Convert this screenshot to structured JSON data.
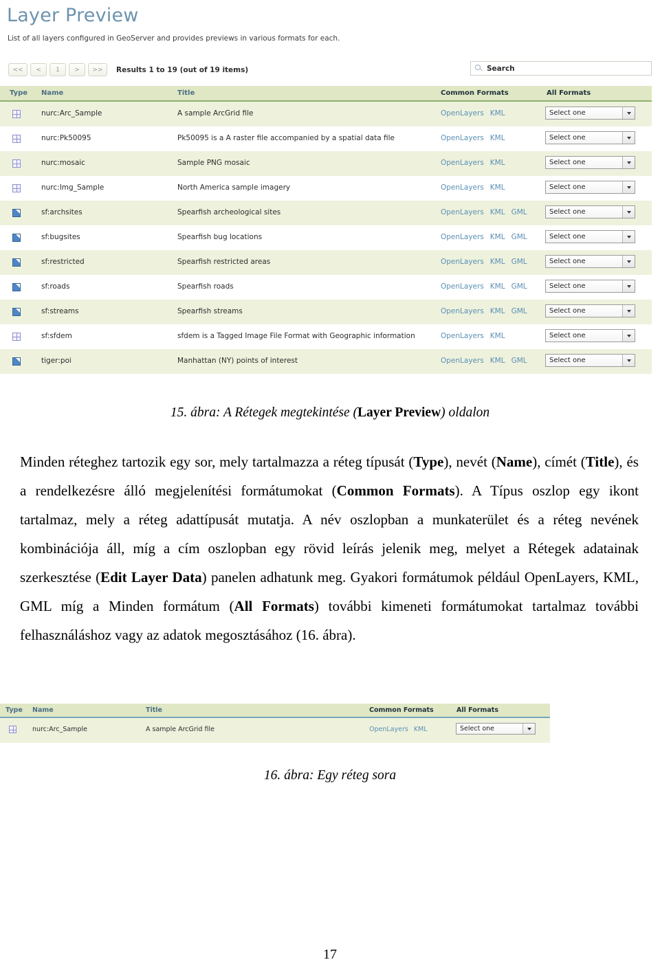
{
  "figure15": {
    "app_title": "Layer Preview",
    "description": "List of all layers configured in GeoServer and provides previews in various formats for each.",
    "pager": {
      "first_label": "<<",
      "prev_label": "<",
      "page_label": "1",
      "next_label": ">",
      "last_label": ">>",
      "results_text": "Results 1 to 19 (out of 19 items)"
    },
    "search": {
      "placeholder": "Search",
      "icon": "search-icon"
    },
    "columns": {
      "type": "Type",
      "name": "Name",
      "title": "Title",
      "common_formats": "Common Formats",
      "all_formats": "All Formats"
    },
    "select_placeholder": "Select one",
    "rows": [
      {
        "type_icon": "raster-grid-icon",
        "type": "raster",
        "name": "nurc:Arc_Sample",
        "title": "A sample ArcGrid file",
        "formats": [
          "OpenLayers",
          "KML"
        ],
        "all_formats": "Select one"
      },
      {
        "type_icon": "raster-grid-icon",
        "type": "raster",
        "name": "nurc:Pk50095",
        "title": "Pk50095 is a A raster file accompanied by a spatial data file",
        "formats": [
          "OpenLayers",
          "KML"
        ],
        "all_formats": "Select one"
      },
      {
        "type_icon": "raster-grid-icon",
        "type": "raster",
        "name": "nurc:mosaic",
        "title": "Sample PNG mosaic",
        "formats": [
          "OpenLayers",
          "KML"
        ],
        "all_formats": "Select one"
      },
      {
        "type_icon": "raster-grid-icon",
        "type": "raster",
        "name": "nurc:Img_Sample",
        "title": "North America sample imagery",
        "formats": [
          "OpenLayers",
          "KML"
        ],
        "all_formats": "Select one"
      },
      {
        "type_icon": "vector-polygon-icon",
        "type": "vector",
        "name": "sf:archsites",
        "title": "Spearfish archeological sites",
        "formats": [
          "OpenLayers",
          "KML",
          "GML"
        ],
        "all_formats": "Select one"
      },
      {
        "type_icon": "vector-polygon-icon",
        "type": "vector",
        "name": "sf:bugsites",
        "title": "Spearfish bug locations",
        "formats": [
          "OpenLayers",
          "KML",
          "GML"
        ],
        "all_formats": "Select one"
      },
      {
        "type_icon": "vector-polygon-icon",
        "type": "vector",
        "name": "sf:restricted",
        "title": "Spearfish restricted areas",
        "formats": [
          "OpenLayers",
          "KML",
          "GML"
        ],
        "all_formats": "Select one"
      },
      {
        "type_icon": "vector-polygon-icon",
        "type": "vector",
        "name": "sf:roads",
        "title": "Spearfish roads",
        "formats": [
          "OpenLayers",
          "KML",
          "GML"
        ],
        "all_formats": "Select one"
      },
      {
        "type_icon": "vector-polygon-icon",
        "type": "vector",
        "name": "sf:streams",
        "title": "Spearfish streams",
        "formats": [
          "OpenLayers",
          "KML",
          "GML"
        ],
        "all_formats": "Select one"
      },
      {
        "type_icon": "raster-grid-icon",
        "type": "raster",
        "name": "sf:sfdem",
        "title": "sfdem is a Tagged Image File Format with Geographic information",
        "formats": [
          "OpenLayers",
          "KML"
        ],
        "all_formats": "Select one"
      },
      {
        "type_icon": "vector-polygon-icon",
        "type": "vector",
        "name": "tiger:poi",
        "title": "Manhattan (NY) points of interest",
        "formats": [
          "OpenLayers",
          "KML",
          "GML"
        ],
        "all_formats": "Select one"
      }
    ]
  },
  "caption15": {
    "prefix": "15. ábra: A Rétegek megtekintése (",
    "bold": "Layer Preview",
    "suffix": ") oldalon"
  },
  "body_paragraph": {
    "seg1": "Minden réteghez tartozik egy sor, mely tartalmazza a réteg típusát (",
    "b1": "Type",
    "seg2": "), nevét (",
    "b2": "Name",
    "seg3": "), címét (",
    "b3": "Title",
    "seg4": "), és a rendelkezésre álló megjelenítési formátumokat (",
    "b4": "Common Formats",
    "seg5": "). A Típus oszlop egy ikont tartalmaz, mely a réteg adattípusát mutatja. A név oszlopban a munkaterület és a réteg nevének kombinációja áll, míg a cím oszlopban egy rövid leírás jelenik meg, melyet a Rétegek adatainak szerkesztése (",
    "b5": "Edit Layer Data",
    "seg6": ") panelen adhatunk meg. Gyakori formátumok például OpenLayers, KML, GML míg a Minden formátum (",
    "b6": "All Formats",
    "seg7": ") további kimeneti formátumokat tartalmaz további felhasználáshoz vagy az adatok megosztásához (16. ábra)."
  },
  "figure16": {
    "columns": {
      "type": "Type",
      "name": "Name",
      "title": "Title",
      "common_formats": "Common Formats",
      "all_formats": "All Formats"
    },
    "row": {
      "type_icon": "raster-grid-icon",
      "name": "nurc:Arc_Sample",
      "title": "A sample ArcGrid file",
      "format1": "OpenLayers",
      "format2": "KML",
      "all_formats": "Select one"
    }
  },
  "caption16": {
    "text": "16. ábra: Egy réteg sora"
  },
  "page_number": "17",
  "colors": {
    "header_title": "#6d93ae",
    "table_header_bg": "#dfe7c4",
    "row_alt_bg": "#eef2dd",
    "link": "#5b8fb5",
    "column_header": "#4d6e86"
  }
}
